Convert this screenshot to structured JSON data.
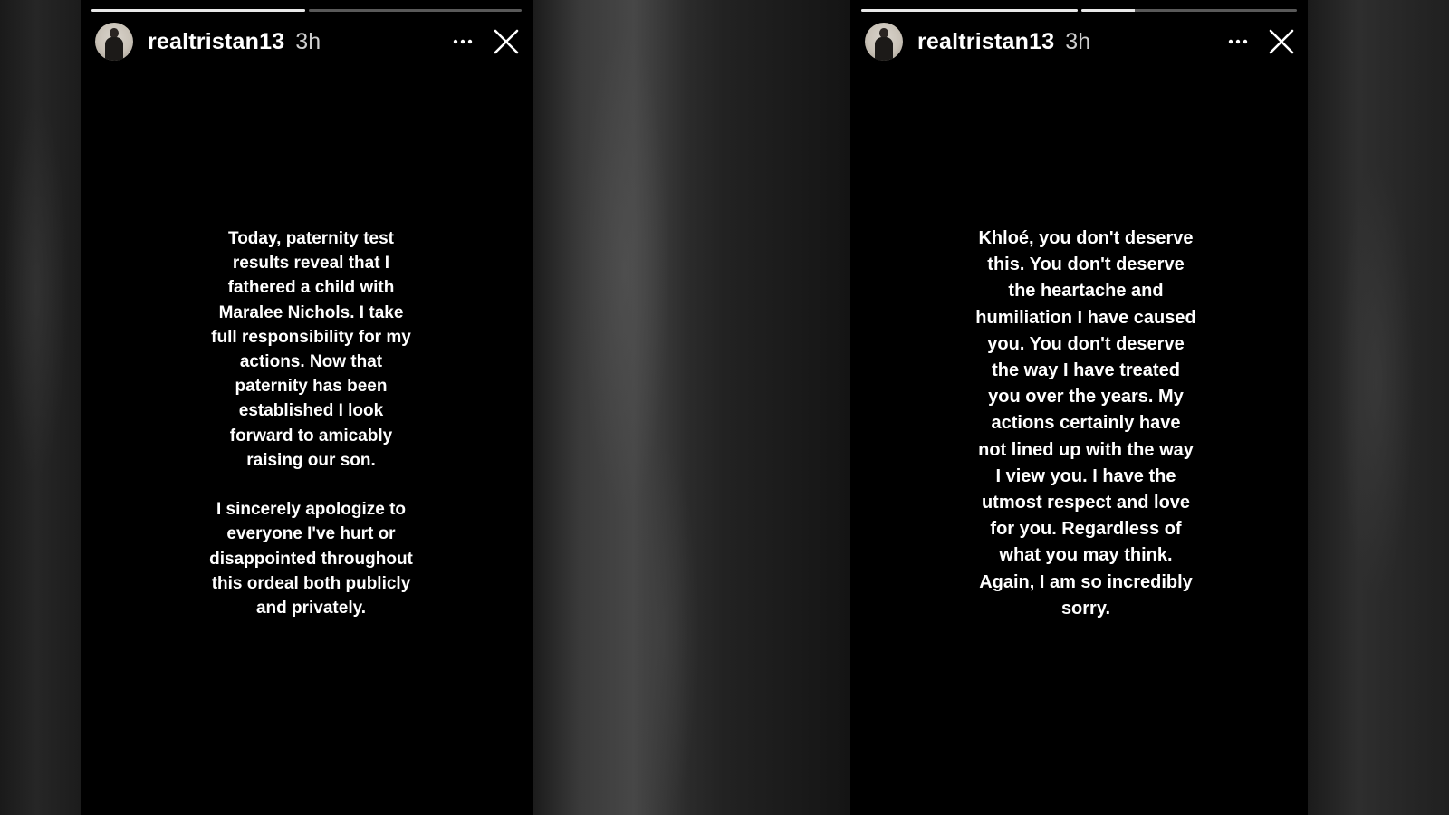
{
  "stories": [
    {
      "username": "realtristan13",
      "time": "3h",
      "progress": [
        1.0,
        0.0
      ],
      "text": "Today, paternity test\nresults reveal that I\nfathered a child with\nMaralee Nichols. I take\nfull responsibility for my\nactions. Now that\npaternity has been\nestablished I look\nforward to amicably\nraising our son.\n\nI sincerely apologize to\neveryone I've hurt or\ndisappointed throughout\nthis ordeal both publicly\nand privately."
    },
    {
      "username": "realtristan13",
      "time": "3h",
      "progress": [
        1.0,
        0.25
      ],
      "text": "Khloé, you don't deserve\nthis. You don't deserve\nthe heartache and\nhumiliation I have caused\nyou. You don't deserve\nthe way I have treated\nyou over the years. My\nactions certainly have\nnot lined up with the way\nI view you. I have the\nutmost respect and love\nfor you. Regardless of\nwhat you may think.\nAgain, I am so incredibly\nsorry."
    }
  ],
  "icons": {
    "more": "more-options-icon",
    "close": "close-icon"
  },
  "colors": {
    "story_bg": "#000000",
    "text": "#ffffff",
    "progress_fill": "#e8e8e8",
    "progress_track": "rgba(255,255,255,0.35)"
  }
}
